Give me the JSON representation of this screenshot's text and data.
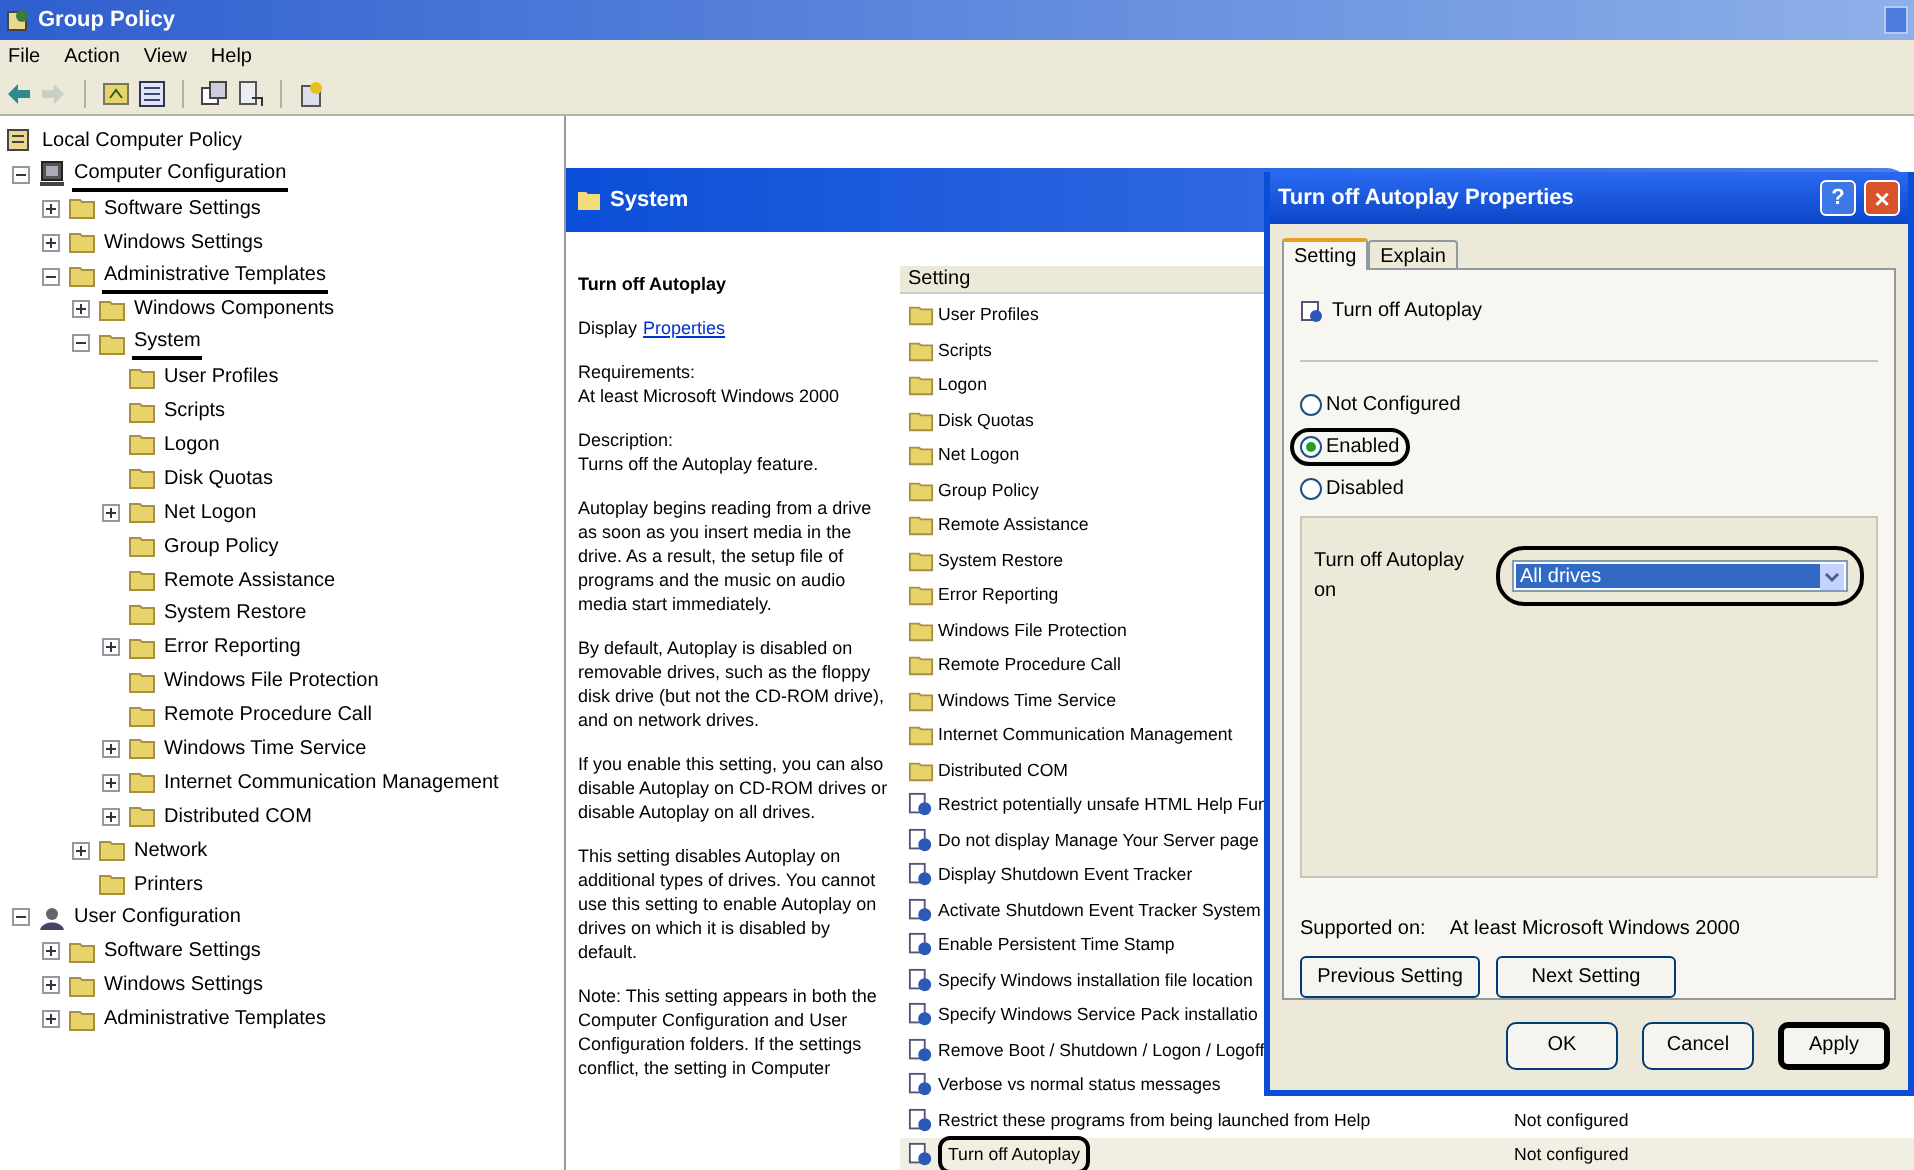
{
  "window": {
    "title": "Group Policy"
  },
  "menu": [
    "File",
    "Action",
    "View",
    "Help"
  ],
  "toolbar": [
    {
      "kind": "back",
      "disabled": false
    },
    {
      "kind": "forward",
      "disabled": true
    },
    {
      "kind": "up",
      "disabled": false
    },
    {
      "kind": "pane",
      "disabled": false
    },
    {
      "kind": "export",
      "disabled": false
    },
    {
      "kind": "props",
      "disabled": false
    },
    {
      "kind": "help",
      "disabled": false
    }
  ],
  "tree": [
    {
      "label": "Local Computer Policy",
      "kind": "policy",
      "underlined": false,
      "children": [
        {
          "label": "Computer Configuration",
          "kind": "computer",
          "expanded": true,
          "underlined": true,
          "children": [
            {
              "label": "Software Settings",
              "expanded": false,
              "underlined": false
            },
            {
              "label": "Windows Settings",
              "expanded": false,
              "underlined": false
            },
            {
              "label": "Administrative Templates",
              "expanded": true,
              "underlined": true,
              "children": [
                {
                  "label": "Windows Components",
                  "expanded": false,
                  "underlined": false
                },
                {
                  "label": "System",
                  "expanded": true,
                  "underlined": true,
                  "children": [
                    {
                      "label": "User Profiles",
                      "underlined": false
                    },
                    {
                      "label": "Scripts",
                      "underlined": false
                    },
                    {
                      "label": "Logon",
                      "underlined": false
                    },
                    {
                      "label": "Disk Quotas",
                      "underlined": false
                    },
                    {
                      "label": "Net Logon",
                      "expanded": false,
                      "underlined": false
                    },
                    {
                      "label": "Group Policy",
                      "underlined": false
                    },
                    {
                      "label": "Remote Assistance",
                      "underlined": false
                    },
                    {
                      "label": "System Restore",
                      "underlined": false
                    },
                    {
                      "label": "Error Reporting",
                      "expanded": false,
                      "underlined": false
                    },
                    {
                      "label": "Windows File Protection",
                      "underlined": false
                    },
                    {
                      "label": "Remote Procedure Call",
                      "underlined": false
                    },
                    {
                      "label": "Windows Time Service",
                      "expanded": false,
                      "underlined": false
                    },
                    {
                      "label": "Internet Communication Management",
                      "expanded": false,
                      "underlined": false
                    },
                    {
                      "label": "Distributed COM",
                      "expanded": false,
                      "underlined": false
                    }
                  ]
                },
                {
                  "label": "Network",
                  "expanded": false,
                  "underlined": false
                },
                {
                  "label": "Printers",
                  "underlined": false
                }
              ]
            }
          ]
        },
        {
          "label": "User Configuration",
          "kind": "user",
          "expanded": true,
          "underlined": false,
          "children": [
            {
              "label": "Software Settings",
              "expanded": false,
              "underlined": false
            },
            {
              "label": "Windows Settings",
              "expanded": false,
              "underlined": false
            },
            {
              "label": "Administrative Templates",
              "expanded": false,
              "underlined": false
            }
          ]
        }
      ]
    }
  ],
  "pane_header": "System",
  "description": {
    "title": "Turn off Autoplay",
    "display_label": "Display",
    "display_link": "Properties",
    "paragraphs": [
      "Requirements:\nAt least Microsoft Windows 2000",
      "Description:\nTurns off the Autoplay feature.",
      "Autoplay begins reading from a drive as soon as you insert media in the drive. As a result, the setup file of programs and the music on audio media start immediately.",
      "By default, Autoplay is disabled on removable drives, such as the floppy disk drive (but not the CD-ROM drive), and on network drives.",
      "If you enable this setting, you can also disable Autoplay on CD-ROM drives or disable Autoplay on all drives.",
      "This setting disables Autoplay on additional types of drives. You cannot use this setting to enable Autoplay on drives on which it is disabled by default.",
      "Note: This setting appears in both the Computer Configuration and User Configuration folders. If the settings conflict, the setting in Computer"
    ]
  },
  "settings": {
    "column": "Setting",
    "rows": [
      {
        "kind": "folder",
        "name": "User Profiles",
        "selected": false,
        "circled": false
      },
      {
        "kind": "folder",
        "name": "Scripts",
        "selected": false,
        "circled": false
      },
      {
        "kind": "folder",
        "name": "Logon",
        "selected": false,
        "circled": false
      },
      {
        "kind": "folder",
        "name": "Disk Quotas",
        "selected": false,
        "circled": false
      },
      {
        "kind": "folder",
        "name": "Net Logon",
        "selected": false,
        "circled": false
      },
      {
        "kind": "folder",
        "name": "Group Policy",
        "selected": false,
        "circled": false
      },
      {
        "kind": "folder",
        "name": "Remote Assistance",
        "selected": false,
        "circled": false
      },
      {
        "kind": "folder",
        "name": "System Restore",
        "selected": false,
        "circled": false
      },
      {
        "kind": "folder",
        "name": "Error Reporting",
        "selected": false,
        "circled": false
      },
      {
        "kind": "folder",
        "name": "Windows File Protection",
        "selected": false,
        "circled": false
      },
      {
        "kind": "folder",
        "name": "Remote Procedure Call",
        "selected": false,
        "circled": false
      },
      {
        "kind": "folder",
        "name": "Windows Time Service",
        "selected": false,
        "circled": false
      },
      {
        "kind": "folder",
        "name": "Internet Communication Management",
        "selected": false,
        "circled": false
      },
      {
        "kind": "folder",
        "name": "Distributed COM",
        "selected": false,
        "circled": false
      },
      {
        "kind": "policy",
        "name": "Restrict potentially unsafe HTML Help Fun",
        "selected": false,
        "circled": false
      },
      {
        "kind": "policy",
        "name": "Do not display Manage Your Server page",
        "selected": false,
        "circled": false
      },
      {
        "kind": "policy",
        "name": "Display Shutdown Event Tracker",
        "selected": false,
        "circled": false
      },
      {
        "kind": "policy",
        "name": "Activate Shutdown Event Tracker System",
        "selected": false,
        "circled": false
      },
      {
        "kind": "policy",
        "name": "Enable Persistent Time Stamp",
        "selected": false,
        "circled": false
      },
      {
        "kind": "policy",
        "name": "Specify Windows installation file location",
        "selected": false,
        "circled": false
      },
      {
        "kind": "policy",
        "name": "Specify Windows Service Pack installatio",
        "selected": false,
        "circled": false
      },
      {
        "kind": "policy",
        "name": "Remove Boot / Shutdown / Logon / Logoff",
        "selected": false,
        "circled": false
      },
      {
        "kind": "policy",
        "name": "Verbose vs normal status messages",
        "selected": false,
        "circled": false
      },
      {
        "kind": "policy",
        "name": "Restrict these programs from being launched from Help",
        "state": "Not configured",
        "selected": false,
        "circled": false
      },
      {
        "kind": "policy",
        "name": "Turn off Autoplay",
        "state": "Not configured",
        "selected": true,
        "circled": true
      }
    ]
  },
  "dialog": {
    "title": "Turn off Autoplay Properties",
    "help_button": "?",
    "close_button": "×",
    "tabs": [
      {
        "label": "Setting",
        "selected": true
      },
      {
        "label": "Explain",
        "selected": false
      }
    ],
    "policy_name": "Turn off Autoplay",
    "options": [
      {
        "label": "Not Configured",
        "selected": false,
        "circled": false
      },
      {
        "label": "Enabled",
        "selected": true,
        "circled": true
      },
      {
        "label": "Disabled",
        "selected": false,
        "circled": false
      }
    ],
    "drive_label": "Turn off Autoplay on",
    "drive_value": "All drives",
    "drive_circled": true,
    "supported_label": "Supported on:",
    "supported_value": "At least Microsoft Windows 2000",
    "nav_buttons": [
      "Previous Setting",
      "Next Setting"
    ],
    "buttons": [
      {
        "label": "OK",
        "circled": false
      },
      {
        "label": "Cancel",
        "circled": false
      },
      {
        "label": "Apply",
        "circled": true
      }
    ]
  }
}
